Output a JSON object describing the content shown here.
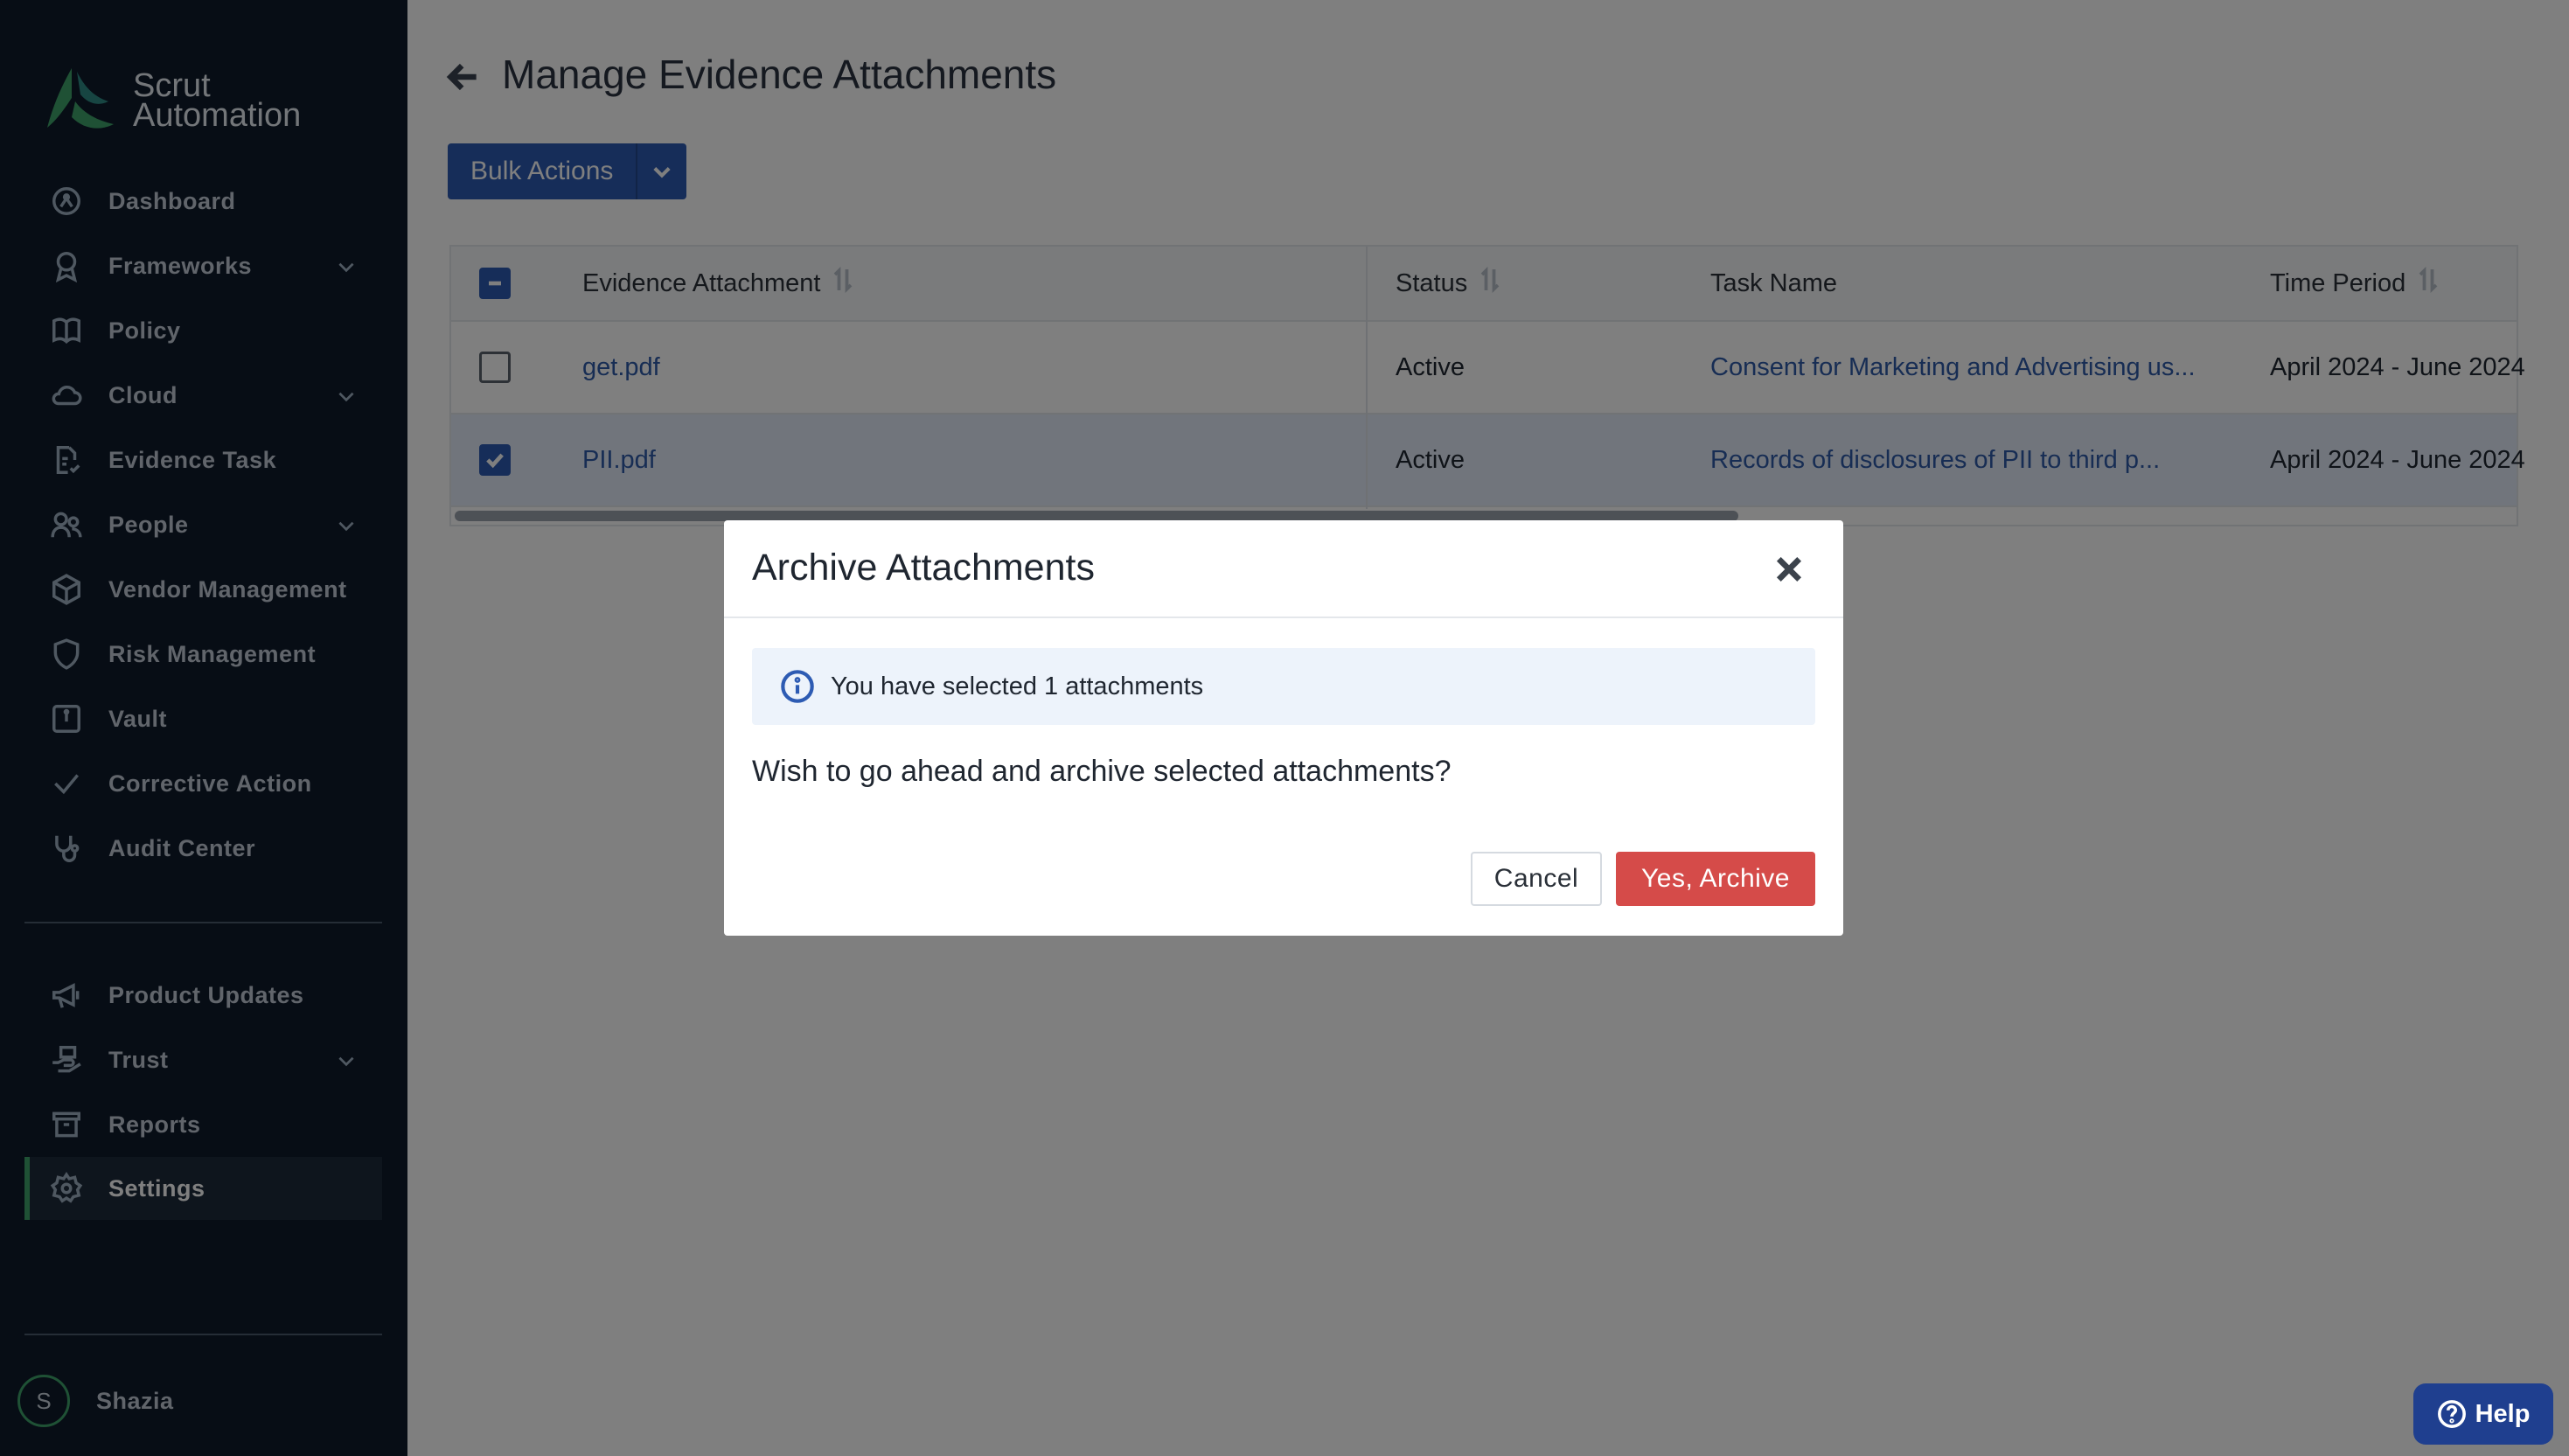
{
  "brand": {
    "line1": "Scrut",
    "line2": "Automation"
  },
  "sidebar": {
    "items": [
      {
        "label": "Dashboard",
        "icon": "dashboard-icon"
      },
      {
        "label": "Frameworks",
        "icon": "award-icon",
        "expandable": true
      },
      {
        "label": "Policy",
        "icon": "book-icon"
      },
      {
        "label": "Cloud",
        "icon": "cloud-icon",
        "expandable": true
      },
      {
        "label": "Evidence Task",
        "icon": "file-check-icon"
      },
      {
        "label": "People",
        "icon": "users-icon",
        "expandable": true
      },
      {
        "label": "Vendor Management",
        "icon": "box-icon"
      },
      {
        "label": "Risk Management",
        "icon": "shield-icon"
      },
      {
        "label": "Vault",
        "icon": "vault-icon"
      },
      {
        "label": "Corrective Action",
        "icon": "check-icon"
      },
      {
        "label": "Audit Center",
        "icon": "stethoscope-icon"
      }
    ],
    "bottom_items": [
      {
        "label": "Product Updates",
        "icon": "megaphone-icon"
      },
      {
        "label": "Trust",
        "icon": "trust-icon",
        "expandable": true
      },
      {
        "label": "Reports",
        "icon": "archive-icon"
      },
      {
        "label": "Settings",
        "icon": "gear-icon",
        "active": true
      }
    ],
    "user": {
      "initial": "S",
      "name": "Shazia"
    }
  },
  "page": {
    "title": "Manage Evidence Attachments",
    "bulk_actions": "Bulk Actions"
  },
  "table": {
    "columns": [
      "Evidence Attachment",
      "Status",
      "Task Name",
      "Time Period"
    ],
    "rows": [
      {
        "attachment": "get.pdf",
        "status": "Active",
        "task": "Consent for Marketing and Advertising us...",
        "period": "April 2024 - June 2024",
        "selected": false
      },
      {
        "attachment": "PII.pdf",
        "status": "Active",
        "task": "Records of disclosures of PII to third p...",
        "period": "April 2024 - June 2024",
        "selected": true
      }
    ]
  },
  "modal": {
    "title": "Archive Attachments",
    "info": "You have selected 1 attachments",
    "question": "Wish to go ahead and archive selected attachments?",
    "cancel": "Cancel",
    "confirm": "Yes, Archive"
  },
  "help": {
    "label": "Help"
  },
  "colors": {
    "accent": "#2d5bb3",
    "danger": "#d54b49",
    "sidebar_bg": "#0e1a2b",
    "active_bar": "#3fa26a"
  }
}
